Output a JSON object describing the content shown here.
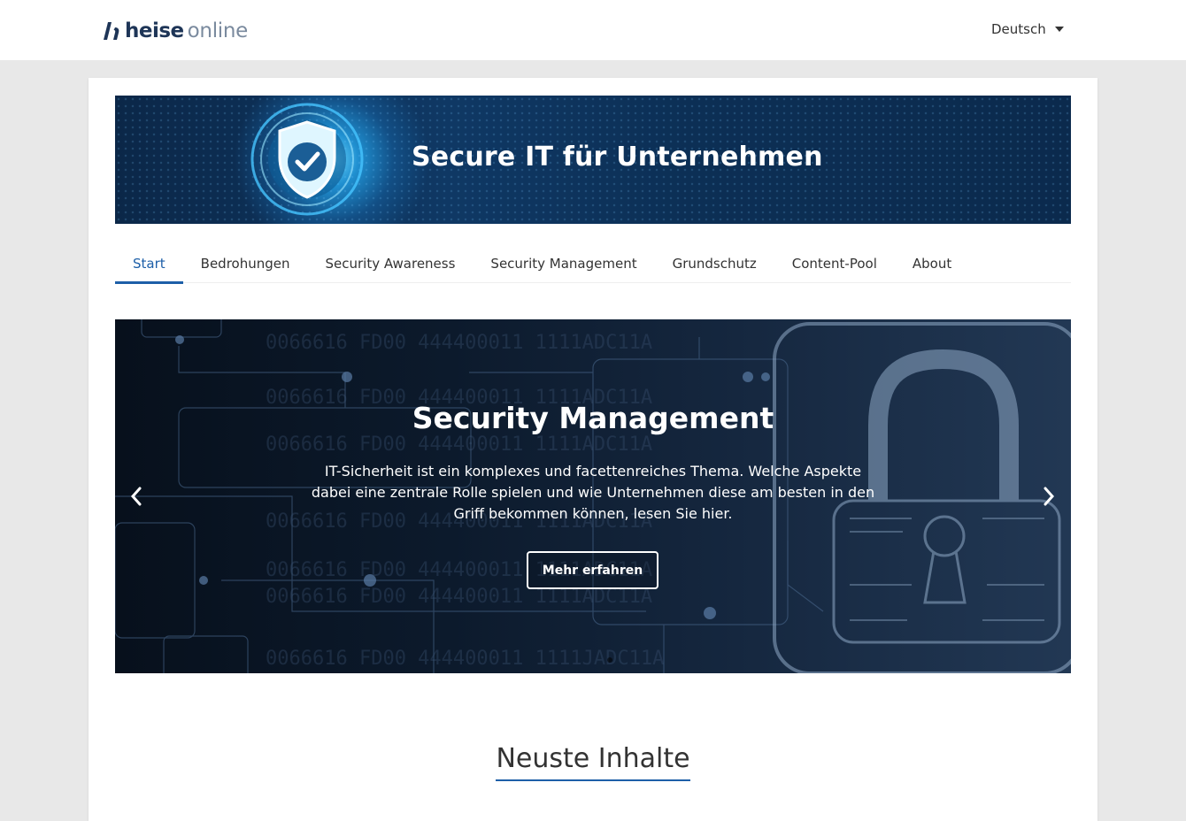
{
  "header": {
    "logo_word1": "heise",
    "logo_word2": "online",
    "language": "Deutsch"
  },
  "banner": {
    "title": "Secure IT für Unternehmen"
  },
  "nav": {
    "tabs": [
      {
        "label": "Start",
        "active": true
      },
      {
        "label": "Bedrohungen",
        "active": false
      },
      {
        "label": "Security Awareness",
        "active": false
      },
      {
        "label": "Security Management",
        "active": false
      },
      {
        "label": "Grundschutz",
        "active": false
      },
      {
        "label": "Content-Pool",
        "active": false
      },
      {
        "label": "About",
        "active": false
      }
    ]
  },
  "carousel": {
    "title": "Security Management",
    "text": "IT-Sicherheit ist ein komplexes und facettenreiches Thema. Welche Aspekte dabei eine zentrale Rolle spielen und wie Unternehmen diese am besten in den Griff bekommen können, lesen Sie hier.",
    "button_label": "Mehr erfahren"
  },
  "section": {
    "title": "Neuste Inhalte"
  },
  "colors": {
    "accent": "#1d5fa8",
    "brand_dark": "#1e3557",
    "brand_light": "#7a8a9e"
  }
}
